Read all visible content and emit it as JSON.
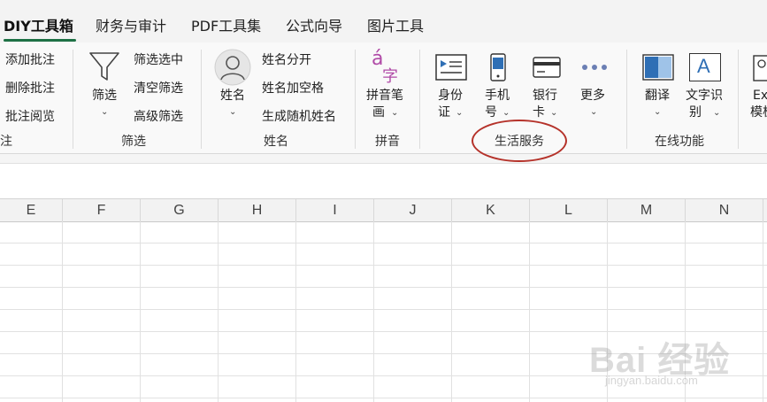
{
  "tabs": [
    {
      "label": "DIY工具箱",
      "active": true
    },
    {
      "label": "财务与审计"
    },
    {
      "label": "PDF工具集"
    },
    {
      "label": "公式向导"
    },
    {
      "label": "图片工具"
    }
  ],
  "groups": {
    "comments": {
      "label": "批注",
      "items": [
        "添加批注",
        "删除批注",
        "批注阅览"
      ]
    },
    "filter": {
      "label": "筛选",
      "big_button": "筛选",
      "items": [
        "筛选选中",
        "清空筛选",
        "高级筛选"
      ]
    },
    "name": {
      "label": "姓名",
      "big_button": "姓名",
      "items": [
        "姓名分开",
        "姓名加空格",
        "生成随机姓名"
      ]
    },
    "pinyin": {
      "label": "拼音",
      "button_line1": "拼音笔",
      "button_line2": "画",
      "icon_char_top": "á",
      "icon_char_bottom": "字"
    },
    "life": {
      "label": "生活服务",
      "buttons": [
        {
          "line1": "身份",
          "line2": "证"
        },
        {
          "line1": "手机",
          "line2": "号"
        },
        {
          "line1": "银行",
          "line2": "卡"
        },
        {
          "line1": "更多",
          "line2": ""
        }
      ]
    },
    "online": {
      "label": "在线功能",
      "buttons": [
        {
          "line1": "翻译",
          "line2": ""
        },
        {
          "line1": "文字识",
          "line2": "别",
          "icon_letter": "A"
        }
      ]
    },
    "excel": {
      "line1": "Ex",
      "line2": "模板"
    }
  },
  "columns": [
    "E",
    "F",
    "G",
    "H",
    "I",
    "J",
    "K",
    "L",
    "M",
    "N"
  ],
  "watermark": {
    "big": "Bai 经验",
    "small": "jingyan.baidu.com"
  },
  "colors": {
    "accent": "#1e7145",
    "highlight": "#b5322a",
    "icon_blue": "#2f6fb5",
    "pinyin_purple": "#b04aa7"
  }
}
